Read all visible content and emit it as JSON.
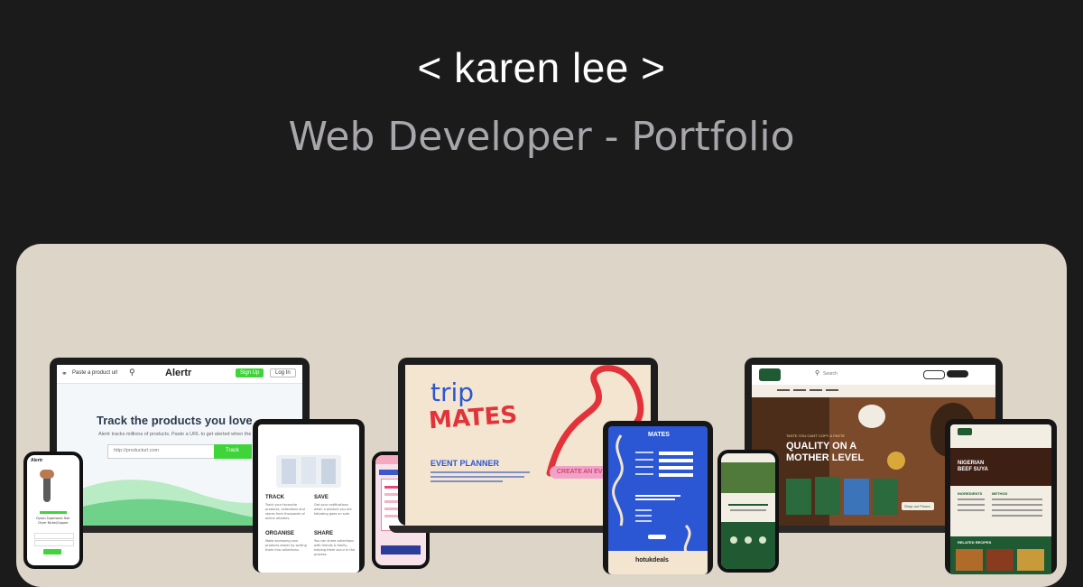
{
  "header": {
    "title": "< karen lee >",
    "subtitle": "Web Developer - Portfolio"
  },
  "colors": {
    "background": "#1c1b1c",
    "panel": "#ddd5c8",
    "alertr_green": "#3fd53a",
    "tripmates_red": "#e2333b",
    "tripmates_blue": "#2c57d4",
    "oluolu_green": "#1f5a33"
  },
  "alertr": {
    "paste_label": "Paste a product url",
    "logo": "Alertr",
    "signup": "Sign Up",
    "login": "Log In",
    "hero_title": "Track the products you love",
    "hero_sub": "Alertr tracks millions of products. Paste a URL to get alerted when the pr",
    "url_placeholder": "http://producturl.com",
    "track_button": "Track",
    "features": [
      {
        "title": "TRACK",
        "text": "Track your favourite products, collections and stores from thousands of online retailers."
      },
      {
        "title": "SAVE",
        "text": "Get your notifications when a product you are following goes on sale."
      },
      {
        "title": "ORGANISE",
        "text": "Make accessing your products easier by sorting them into collections."
      },
      {
        "title": "SHARE",
        "text": "You can share collections with friends & family, helping them occur in the process."
      }
    ],
    "phone_product": "Dyson Supersonic Hair Dryer Nickel/Copper"
  },
  "tripmates": {
    "word_trip": "trip",
    "word_mates": "MATES",
    "event_planner": "EVENT PLANNER",
    "create_button": "CREATE AN EVE",
    "brand": "hotukdeals"
  },
  "oluolu": {
    "logo": "Olu Olu",
    "search": "Search",
    "hero_line1": "QUALITY ON A",
    "hero_line2": "MOTHER LEVEL",
    "tagline": "TASTE YOU CAN'T COPY & PASTE",
    "shop_button": "Shop our Flours",
    "recipe_title": "NIGERIAN BEEF SUYA",
    "ingredients": "INGREDIENTS",
    "method": "METHOD",
    "related": "RELATED RECIPES"
  }
}
